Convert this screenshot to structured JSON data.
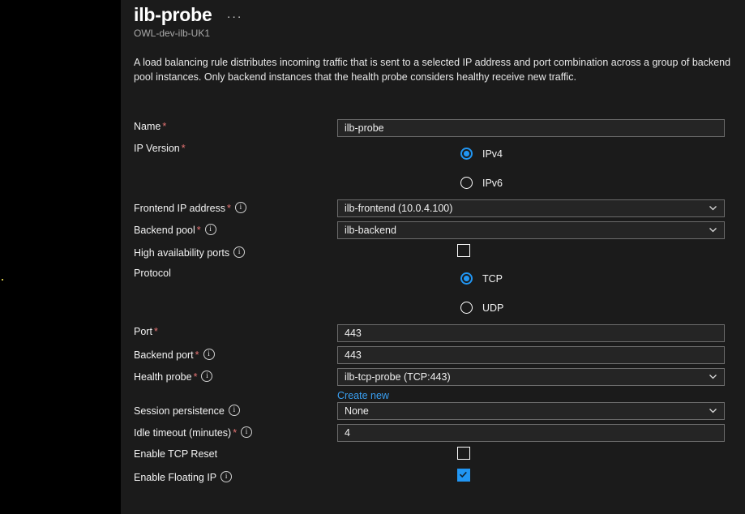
{
  "header": {
    "title": "ilb-probe",
    "subtitle": "OWL-dev-ilb-UK1",
    "ellipsis": "···",
    "description": "A load balancing rule distributes incoming traffic that is sent to a selected IP address and port combination across a group of backend pool instances. Only backend instances that the health probe considers healthy receive new traffic."
  },
  "fields": {
    "name": {
      "label": "Name",
      "required": "*",
      "value": "ilb-probe",
      "placeholder": ""
    },
    "ip_version": {
      "label": "IP Version",
      "required": "*",
      "options": [
        "IPv4",
        "IPv6"
      ],
      "selected": "IPv4"
    },
    "frontend_ip": {
      "label": "Frontend IP address",
      "required": "*",
      "value": "ilb-frontend (10.0.4.100)"
    },
    "backend_pool": {
      "label": "Backend pool",
      "required": "*",
      "value": "ilb-backend"
    },
    "ha_ports": {
      "label": "High availability ports",
      "checked": false
    },
    "protocol": {
      "label": "Protocol",
      "options": [
        "TCP",
        "UDP"
      ],
      "selected": "TCP"
    },
    "port": {
      "label": "Port",
      "required": "*",
      "value": "443"
    },
    "backend_port": {
      "label": "Backend port",
      "required": "*",
      "value": "443"
    },
    "health_probe": {
      "label": "Health probe",
      "required": "*",
      "value": "ilb-tcp-probe (TCP:443)",
      "create_new_link": "Create new"
    },
    "session_persistence": {
      "label": "Session persistence",
      "value": "None"
    },
    "idle_timeout": {
      "label": "Idle timeout (minutes)",
      "required": "*",
      "value": "4"
    },
    "tcp_reset": {
      "label": "Enable TCP Reset",
      "checked": false
    },
    "floating_ip": {
      "label": "Enable Floating IP",
      "checked": true
    }
  },
  "colors": {
    "accent": "#2196f3",
    "link": "#3aa0f3",
    "required": "#e57373",
    "panel_bg": "#1b1b1b",
    "rail_bg": "#000000",
    "input_bg": "#252525"
  }
}
